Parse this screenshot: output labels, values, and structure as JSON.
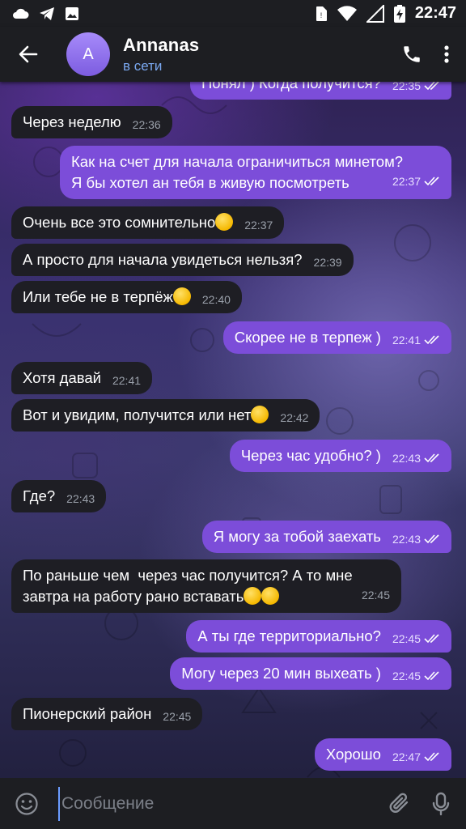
{
  "status_bar": {
    "time": "22:47"
  },
  "header": {
    "avatar_letter": "A",
    "name": "Annanas",
    "status": "в сети"
  },
  "input": {
    "placeholder": "Сообщение"
  },
  "messages": [
    {
      "dir": "out",
      "text": "Понял ) Когда получится?",
      "time": "22:35"
    },
    {
      "dir": "in",
      "text": "Через неделю",
      "time": "22:36"
    },
    {
      "dir": "out",
      "text": "Как на счет для начала ограничиться минетом?\nЯ бы хотел ан тебя в живую посмотреть",
      "time": "22:37"
    },
    {
      "dir": "in",
      "text": "Очень все это сомнительно",
      "emoji": "nerd-face-emoji",
      "time": "22:37"
    },
    {
      "dir": "in",
      "text": "А просто для начала увидеться нельзя?",
      "time": "22:39"
    },
    {
      "dir": "in",
      "text": "Или тебе не в терпёж",
      "emoji": "grinning-face-emoji",
      "time": "22:40"
    },
    {
      "dir": "out",
      "text": "Скорее не в терпеж )",
      "time": "22:41"
    },
    {
      "dir": "in",
      "text": "Хотя давай",
      "time": "22:41"
    },
    {
      "dir": "in",
      "text": "Вот и увидим, получится или нет",
      "emoji": "grinning-face-emoji",
      "time": "22:42"
    },
    {
      "dir": "out",
      "text": "Через час удобно? )",
      "time": "22:43"
    },
    {
      "dir": "in",
      "text": "Где?",
      "time": "22:43"
    },
    {
      "dir": "out",
      "text": "Я могу за тобой заехать",
      "time": "22:43"
    },
    {
      "dir": "in",
      "text": "По раньше чем  через час получится? А то мне\nзавтра на работу рано вставать",
      "emoji": "scream-and-tears-of-joy-emoji",
      "time": "22:45"
    },
    {
      "dir": "out",
      "text": "А ты где территориально?",
      "time": "22:45"
    },
    {
      "dir": "out",
      "text": "Могу через 20 мин выхеать )",
      "time": "22:45"
    },
    {
      "dir": "in",
      "text": "Пионерский район",
      "time": "22:45"
    },
    {
      "dir": "out",
      "text": "Хорошо",
      "time": "22:47"
    }
  ],
  "colors": {
    "incoming_bubble": "#1e1e24",
    "outgoing_bubble": "#7c4dd9",
    "bars": "#1d1e22",
    "online_status": "#7aa8f0"
  }
}
